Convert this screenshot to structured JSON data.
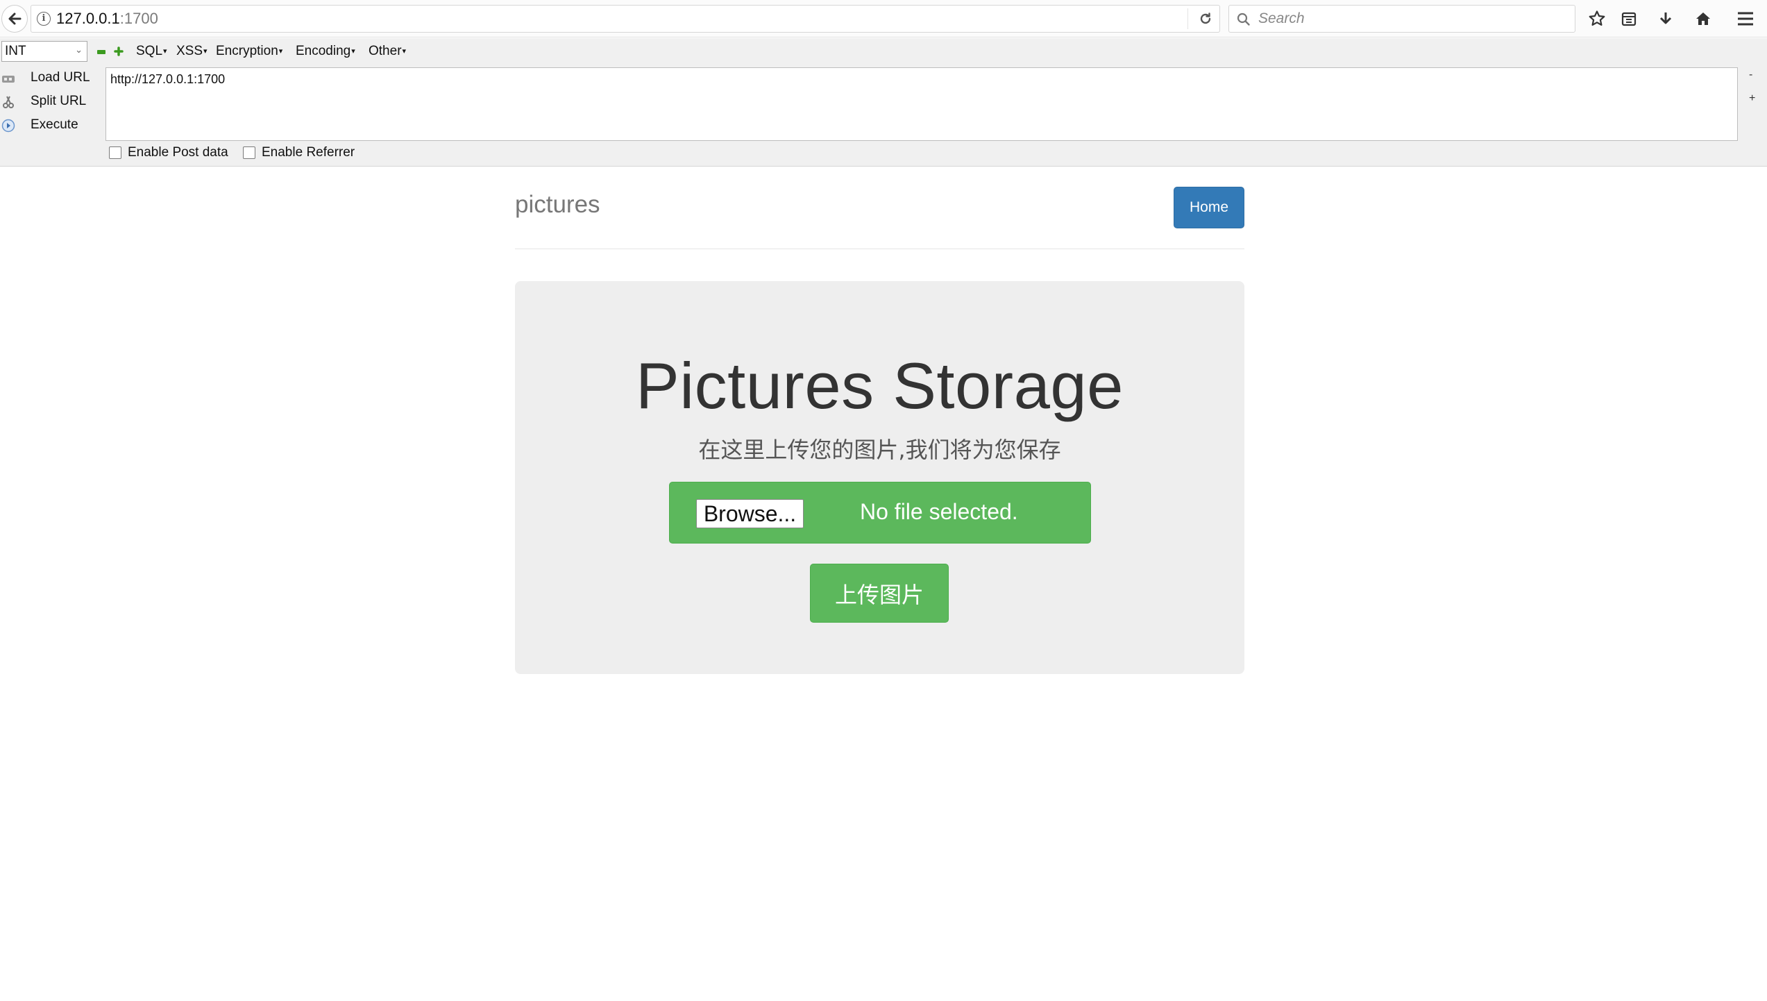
{
  "browser": {
    "url_host": "127.0.0.1",
    "url_port": ":1700",
    "search_placeholder": "Search"
  },
  "hackbar": {
    "select_value": "INT",
    "menus": [
      {
        "label": "SQL"
      },
      {
        "label": "XSS"
      },
      {
        "label": "Encryption"
      },
      {
        "label": "Encoding"
      },
      {
        "label": "Other"
      }
    ],
    "actions": [
      {
        "label": "Load URL",
        "icon": "load-url-icon"
      },
      {
        "label": "Split URL",
        "icon": "split-url-icon"
      },
      {
        "label": "Execute",
        "icon": "execute-icon"
      }
    ],
    "url_value": "http://127.0.0.1:1700",
    "side_minus": "-",
    "side_plus": "+",
    "post_data_label": "Enable Post data",
    "referrer_label": "Enable Referrer"
  },
  "page": {
    "brand": "pictures",
    "home_label": "Home",
    "title": "Pictures Storage",
    "subtitle": "在这里上传您的图片,我们将为您保存",
    "browse_label": "Browse...",
    "no_file_text": "No file selected.",
    "upload_label": "上传图片"
  },
  "colors": {
    "primary": "#337ab7",
    "success": "#5cb85c",
    "jumbotron_bg": "#eeeeee"
  }
}
